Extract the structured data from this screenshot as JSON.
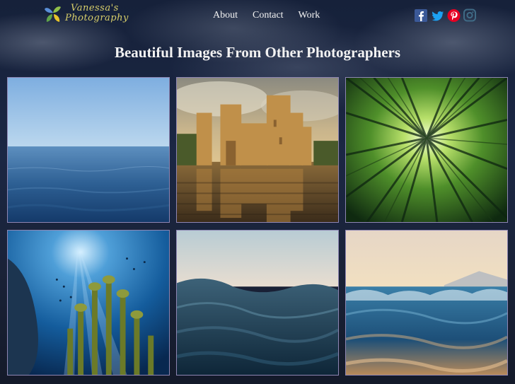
{
  "brand": {
    "line1": "Vanessa's",
    "line2": "Photography"
  },
  "nav": {
    "items": [
      "About",
      "Contact",
      "Work"
    ]
  },
  "social": [
    "facebook-icon",
    "twitter-icon",
    "pinterest-icon",
    "instagram-icon"
  ],
  "colors": {
    "facebook": "#3b5998",
    "twitter": "#1da1f2",
    "pinterest": "#e60023",
    "instagram": "#3f6b86",
    "tile_border": "#8e86b3"
  },
  "main": {
    "title": "Beautiful Images From Other Photographers"
  },
  "gallery": [
    {
      "name": "calm-sea-image"
    },
    {
      "name": "castle-reflection-image"
    },
    {
      "name": "bamboo-forest-image"
    },
    {
      "name": "underwater-coral-image"
    },
    {
      "name": "ocean-wave-closeup-image"
    },
    {
      "name": "sunset-waves-image"
    }
  ]
}
